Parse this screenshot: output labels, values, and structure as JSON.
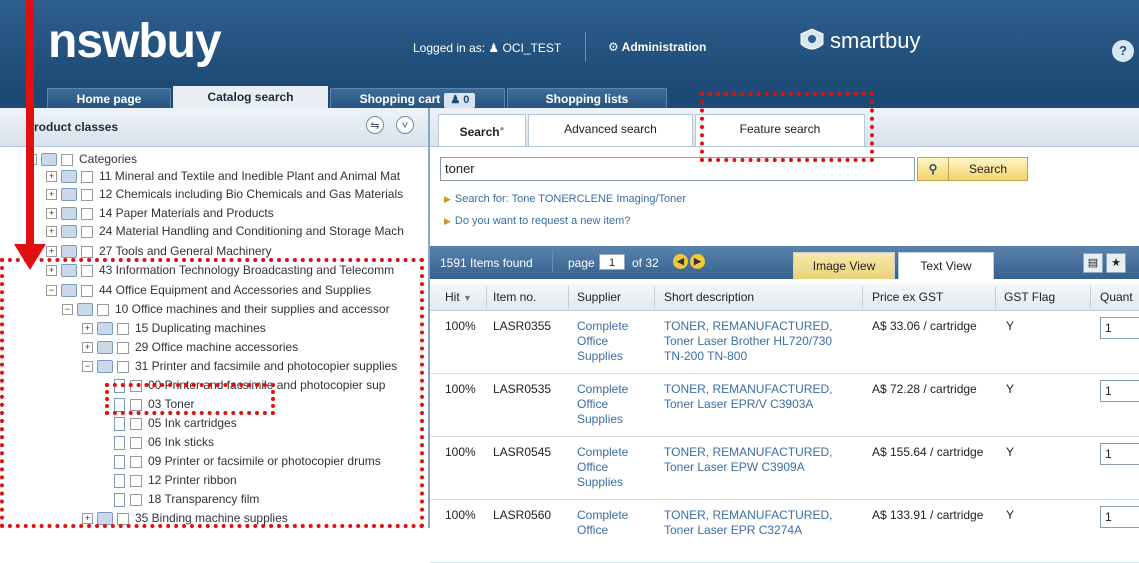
{
  "header": {
    "logo": "nswbuy",
    "logged_in_label": "Logged in as:",
    "user": "OCI_TEST",
    "admin": "Administration",
    "brand": "smartbuy"
  },
  "main_tabs": [
    {
      "label": "Home page"
    },
    {
      "label": "Catalog search"
    },
    {
      "label": "Shopping cart",
      "count": "0"
    },
    {
      "label": "Shopping lists"
    }
  ],
  "left": {
    "title": "roduct classes",
    "tree": [
      {
        "pm": "−",
        "label": "Categories"
      },
      {
        "pm": "+",
        "label": "11 Mineral and Textile and Inedible Plant and Animal Mat"
      },
      {
        "pm": "+",
        "label": "12 Chemicals including Bio Chemicals and Gas Materials"
      },
      {
        "pm": "+",
        "label": "14 Paper Materials and Products"
      },
      {
        "pm": "+",
        "label": "24 Material Handling and Conditioning and Storage Mach"
      },
      {
        "pm": "+",
        "label": "27 Tools and General Machinery"
      },
      {
        "pm": "+",
        "label": "43 Information Technology Broadcasting and Telecomm"
      },
      {
        "pm": "−",
        "label": "44 Office Equipment and Accessories and Supplies"
      },
      {
        "pm": "−",
        "label": "10 Office machines and their supplies and accessor"
      },
      {
        "pm": "+",
        "label": "15 Duplicating machines"
      },
      {
        "pm": "+",
        "label": "29 Office machine accessories"
      },
      {
        "pm": "−",
        "label": "31 Printer and facsimile and photocopier supplies"
      },
      {
        "pm": "",
        "label": "00 Printer and facsimile and photocopier sup"
      },
      {
        "pm": "",
        "label": "03 Toner"
      },
      {
        "pm": "",
        "label": "05 Ink cartridges"
      },
      {
        "pm": "",
        "label": "06 Ink sticks"
      },
      {
        "pm": "",
        "label": "09 Printer or facsimile or photocopier drums"
      },
      {
        "pm": "",
        "label": "12 Printer ribbon"
      },
      {
        "pm": "",
        "label": "18 Transparency film"
      },
      {
        "pm": "+",
        "label": "35 Binding machine supplies"
      }
    ]
  },
  "search_tabs": [
    {
      "label": "Search"
    },
    {
      "label": "Advanced search"
    },
    {
      "label": "Feature search"
    }
  ],
  "search": {
    "query": "toner",
    "button": "Search",
    "hint1": "Search for: Tone TONERCLENE Imaging/Toner",
    "hint2": "Do you want to request a new item?"
  },
  "results": {
    "count": "1591 Items found",
    "page_label": "page",
    "page": "1",
    "of": "of 32",
    "image_view": "Image View",
    "text_view": "Text View",
    "columns": [
      "Hit",
      "Item no.",
      "Supplier",
      "Short description",
      "Price ex GST",
      "GST Flag",
      "Quant"
    ],
    "rows": [
      {
        "hit": "100%",
        "item": "LASR0355",
        "supplier": [
          "Complete",
          "Office",
          "Supplies"
        ],
        "desc": [
          "TONER, REMANUFACTURED,",
          "Toner Laser Brother HL720/730",
          "TN-200 TN-800"
        ],
        "price": "A$ 33.06 / cartridge",
        "gst": "Y",
        "qty": "1"
      },
      {
        "hit": "100%",
        "item": "LASR0535",
        "supplier": [
          "Complete",
          "Office",
          "Supplies"
        ],
        "desc": [
          "TONER, REMANUFACTURED,",
          "Toner Laser EPR/V C3903A",
          ""
        ],
        "price": "A$ 72.28 / cartridge",
        "gst": "Y",
        "qty": "1"
      },
      {
        "hit": "100%",
        "item": "LASR0545",
        "supplier": [
          "Complete",
          "Office",
          "Supplies"
        ],
        "desc": [
          "TONER, REMANUFACTURED,",
          "Toner Laser EPW C3909A",
          ""
        ],
        "price": "A$ 155.64 / cartridge",
        "gst": "Y",
        "qty": "1"
      },
      {
        "hit": "100%",
        "item": "LASR0560",
        "supplier": [
          "Complete",
          "Office",
          ""
        ],
        "desc": [
          "TONER, REMANUFACTURED,",
          "Toner Laser EPR C3274A",
          ""
        ],
        "price": "A$ 133.91 / cartridge",
        "gst": "Y",
        "qty": "1"
      }
    ]
  },
  "colors": {
    "header_blue": "#1d4a75",
    "annotation_red": "#e01010",
    "accent_yellow": "#f2d46b"
  }
}
